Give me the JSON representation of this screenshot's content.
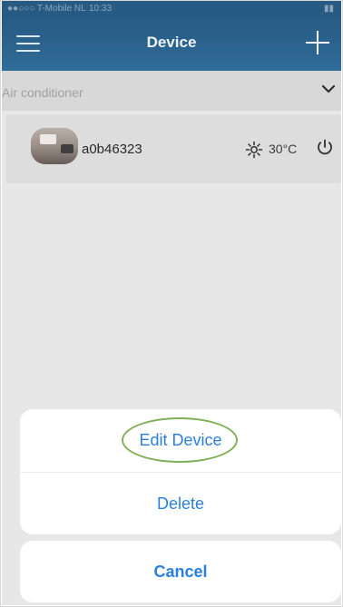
{
  "status_bar": {
    "carrier": "●●○○○ T-Mobile NL",
    "time": "10:33",
    "battery": "▮▮"
  },
  "nav_bar": {
    "title": "Device",
    "left_icon": "menu-icon",
    "right_icon": "add-icon"
  },
  "device_group": {
    "label": "Air conditioner",
    "icon": "chevron-down-icon"
  },
  "device": {
    "name": "a0b46323",
    "mode_icon": "sun-icon",
    "temperature": "30°C",
    "power_icon": "power-icon"
  },
  "action_sheet": {
    "edit_label": "Edit Device",
    "delete_label": "Delete",
    "cancel_label": "Cancel",
    "highlighted_item": "Edit Device",
    "highlight_color": "#7faf57"
  },
  "colors": {
    "nav_bar": "#2f6c97",
    "action_text": "#2c80dd",
    "overlay": "#e7e7e7"
  }
}
